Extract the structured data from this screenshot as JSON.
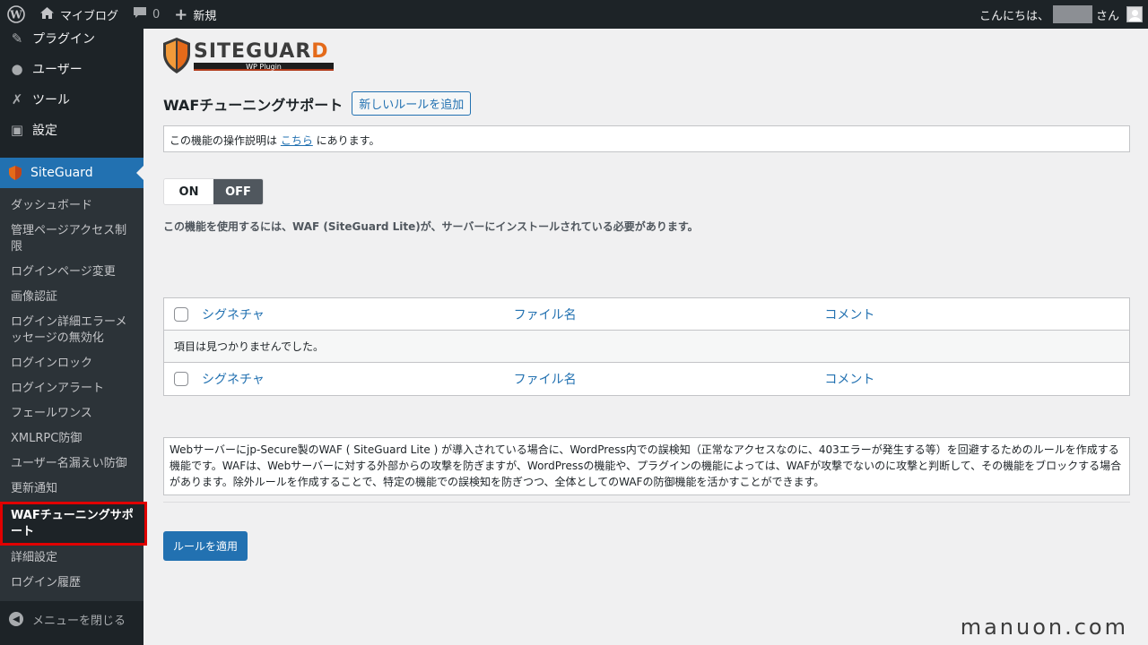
{
  "adminbar": {
    "site_name": "マイブログ",
    "comments_count": "0",
    "new_label": "新規",
    "greeting_prefix": "こんにちは、",
    "greeting_suffix": "さん"
  },
  "sidebar": {
    "top_items": [
      {
        "label": "プラグイン",
        "icon": "plugin-icon"
      },
      {
        "label": "ユーザー",
        "icon": "user-icon"
      },
      {
        "label": "ツール",
        "icon": "wrench-icon"
      },
      {
        "label": "設定",
        "icon": "settings-icon"
      }
    ],
    "current_menu": "SiteGuard",
    "submenu": [
      "ダッシュボード",
      "管理ページアクセス制限",
      "ログインページ変更",
      "画像認証",
      "ログイン詳細エラーメッセージの無効化",
      "ログインロック",
      "ログインアラート",
      "フェールワンス",
      "XMLRPC防御",
      "ユーザー名漏えい防御",
      "更新通知",
      "WAFチューニングサポート",
      "詳細設定",
      "ログイン履歴"
    ],
    "collapse_label": "メニューを閉じる"
  },
  "logo": {
    "word": "SITEGUAR",
    "word_end": "D",
    "sub": "WP Plugin"
  },
  "page": {
    "title": "WAFチューニングサポート",
    "add_button": "新しいルールを追加",
    "notice_before": "この機能の操作説明は ",
    "notice_link": "こちら",
    "notice_after": " にあります。",
    "toggle_on": "ON",
    "toggle_off": "OFF",
    "requirement": "この機能を使用するには、WAF (SiteGuard Lite)が、サーバーにインストールされている必要があります。",
    "table": {
      "columns": [
        "シグネチャ",
        "ファイル名",
        "コメント"
      ],
      "empty_message": "項目は見つかりませんでした。"
    },
    "description": "Webサーバーにjp-Secure製のWAF ( SiteGuard Lite ) が導入されている場合に、WordPress内での誤検知（正常なアクセスなのに、403エラーが発生する等）を回避するためのルールを作成する機能です。WAFは、Webサーバーに対する外部からの攻撃を防ぎますが、WordPressの機能や、プラグインの機能によっては、WAFが攻撃でないのに攻撃と判断して、その機能をブロックする場合があります。除外ルールを作成することで、特定の機能での誤検知を防ぎつつ、全体としてのWAFの防御機能を活かすことができます。",
    "apply_button": "ルールを適用"
  },
  "watermark": "manuon.com",
  "colors": {
    "accent": "#2271b1",
    "sidebar_bg": "#1d2327",
    "highlight": "#e00000"
  }
}
